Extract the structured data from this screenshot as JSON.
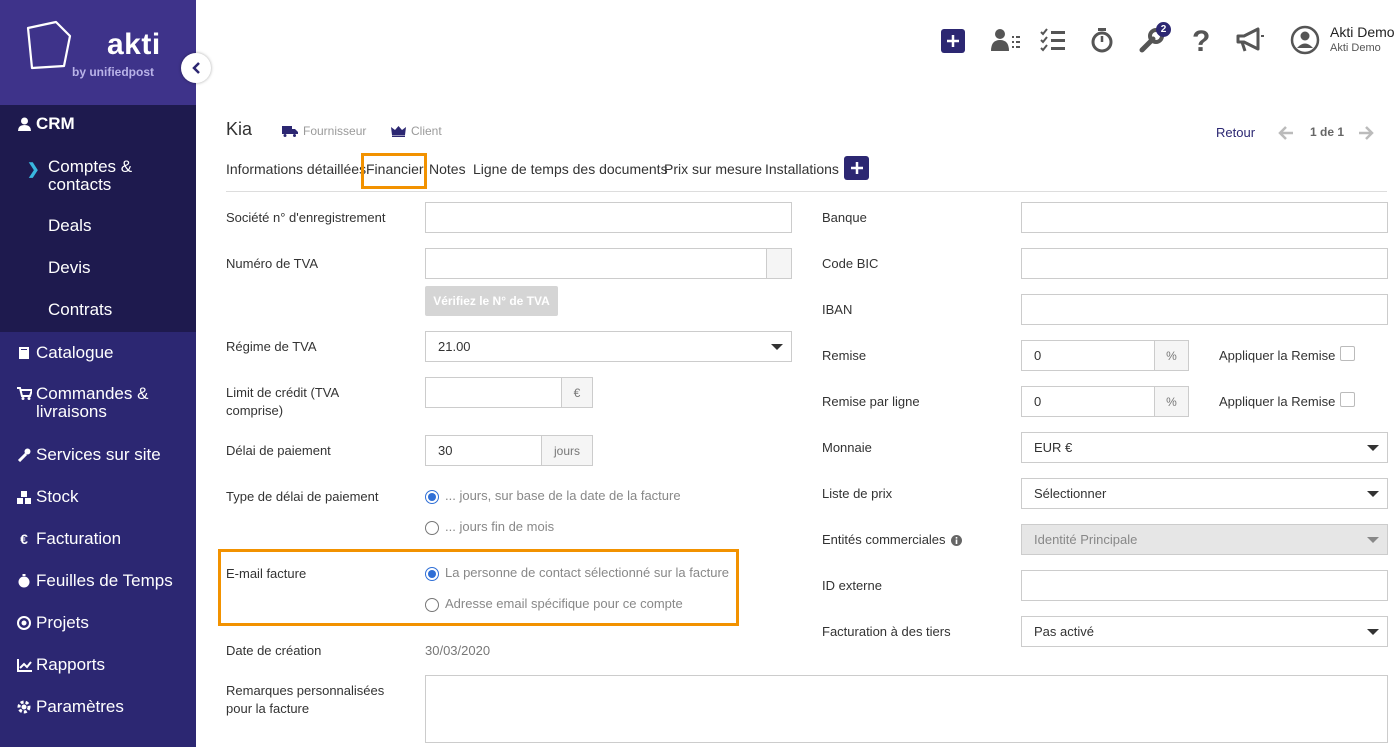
{
  "brand": {
    "name": "akti",
    "sub": "by unifiedpost"
  },
  "sidebar": {
    "crm": "CRM",
    "crm_items": [
      "Comptes &\ncontacts",
      "Deals",
      "Devis",
      "Contrats"
    ],
    "items": [
      "Catalogue",
      "Commandes &\nlivraisons",
      "Services sur site",
      "Stock",
      "Facturation",
      "Feuilles de Temps",
      "Projets",
      "Rapports",
      "Paramètres"
    ]
  },
  "topbar": {
    "notif_count": "2",
    "user_name": "Akti Demo",
    "user_company": "Akti Demo"
  },
  "header": {
    "title": "Kia",
    "tag_supplier": "Fournisseur",
    "tag_client": "Client",
    "back": "Retour",
    "pager": "1 de 1"
  },
  "tabs": [
    "Informations détaillées",
    "Financier",
    "Notes",
    "Ligne de temps des documents",
    "Prix sur mesure",
    "Installations"
  ],
  "left": {
    "reg_label": "Société n° d'enregistrement",
    "vat_label": "Numéro de TVA",
    "vat_check_btn": "Vérifiez le N° de TVA",
    "vat_regime_label": "Régime de TVA",
    "vat_regime_value": "21.00",
    "credit_label": "Limit de crédit (TVA\ncomprise)",
    "credit_unit": "€",
    "delay_label": "Délai de paiement",
    "delay_value": "30",
    "delay_unit": "jours",
    "delay_type_label": "Type de délai de paiement",
    "delay_type_opt1": "... jours, sur base de la date de la facture",
    "delay_type_opt2": "... jours fin de mois",
    "email_label": "E-mail facture",
    "email_opt1": "La personne de contact sélectionné sur la facture",
    "email_opt2": "Adresse email spécifique pour ce compte",
    "created_label": "Date de création",
    "created_value": "30/03/2020",
    "remarks_label": "Remarques personnalisées\npour la facture"
  },
  "right": {
    "bank_label": "Banque",
    "bic_label": "Code BIC",
    "iban_label": "IBAN",
    "discount_label": "Remise",
    "discount_value": "0",
    "discount_unit": "%",
    "apply_discount": "Appliquer la Remise",
    "line_discount_label": "Remise par ligne",
    "line_discount_value": "0",
    "currency_label": "Monnaie",
    "currency_value": "EUR €",
    "pricelist_label": "Liste de prix",
    "pricelist_value": "Sélectionner",
    "entities_label": "Entités commerciales",
    "entities_value": "Identité Principale",
    "extid_label": "ID externe",
    "thirdparty_label": "Facturation à des tiers",
    "thirdparty_value": "Pas activé"
  },
  "colors": {
    "sidebar": "#2c2772",
    "highlight": "#f29200",
    "accent_radio": "#2f6fd6"
  }
}
